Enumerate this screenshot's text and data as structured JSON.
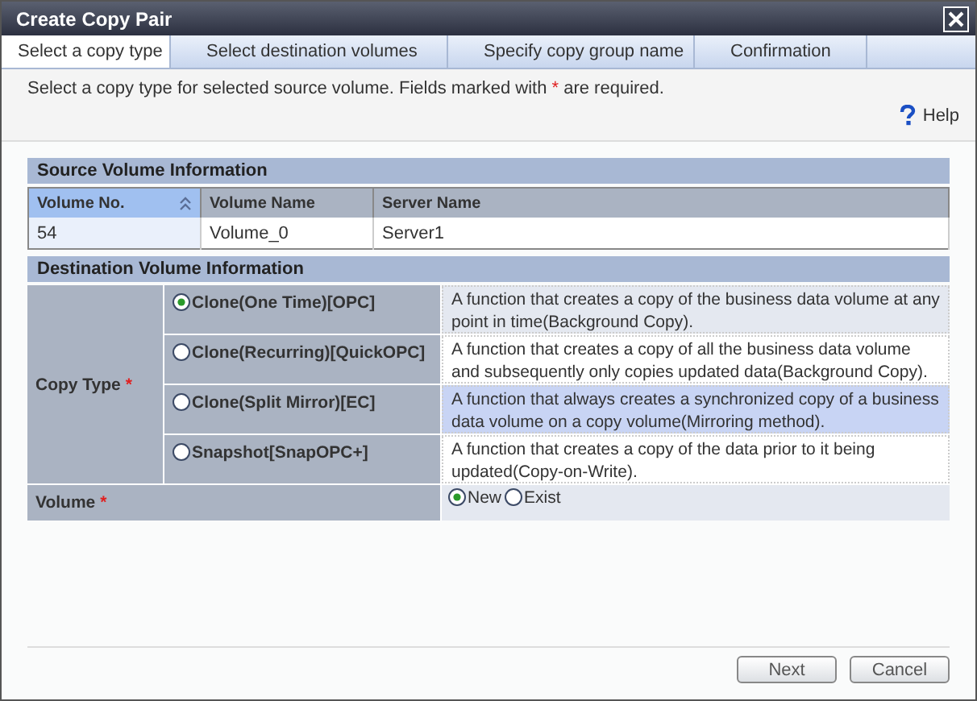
{
  "window": {
    "title": "Create Copy Pair"
  },
  "steps": [
    {
      "label": "Select a copy type",
      "selected": true
    },
    {
      "label": "Select destination volumes",
      "selected": false
    },
    {
      "label": "Specify copy group name",
      "selected": false
    },
    {
      "label": "Confirmation",
      "selected": false
    }
  ],
  "instruction": {
    "before": "Select a copy type for selected source volume. Fields marked with",
    "mark": "*",
    "after": "are required."
  },
  "help": {
    "label": "Help"
  },
  "source": {
    "title": "Source Volume Information",
    "columns": [
      {
        "label": "Volume No.",
        "sorted": true
      },
      {
        "label": "Volume Name",
        "sorted": false
      },
      {
        "label": "Server Name",
        "sorted": false
      }
    ],
    "rows": [
      [
        "54",
        "Volume_0",
        "Server1"
      ]
    ]
  },
  "destination": {
    "title": "Destination Volume Information",
    "copy_type": {
      "label": "Copy Type",
      "mark": "*",
      "options": [
        {
          "label": "Clone(One Time)[OPC]",
          "selected": true,
          "highlighted": false,
          "description": "A function that creates a copy of the business data volume at any point in time(Background Copy)."
        },
        {
          "label": "Clone(Recurring)[QuickOPC]",
          "selected": false,
          "highlighted": false,
          "description": "A function that creates a copy of all the business data volume and subsequently only copies updated data(Background Copy)."
        },
        {
          "label": "Clone(Split Mirror)[EC]",
          "selected": false,
          "highlighted": true,
          "description": "A function that always creates a synchronized copy of a business data volume on a copy volume(Mirroring method)."
        },
        {
          "label": "Snapshot[SnapOPC+]",
          "selected": false,
          "highlighted": false,
          "description": "A function that creates a copy of the data prior to it being updated(Copy-on-Write)."
        }
      ]
    },
    "volume": {
      "label": "Volume",
      "mark": "*",
      "options": [
        {
          "label": "New",
          "selected": true
        },
        {
          "label": "Exist",
          "selected": false
        }
      ]
    }
  },
  "buttons": [
    {
      "label": "Next"
    },
    {
      "label": "Cancel"
    }
  ]
}
